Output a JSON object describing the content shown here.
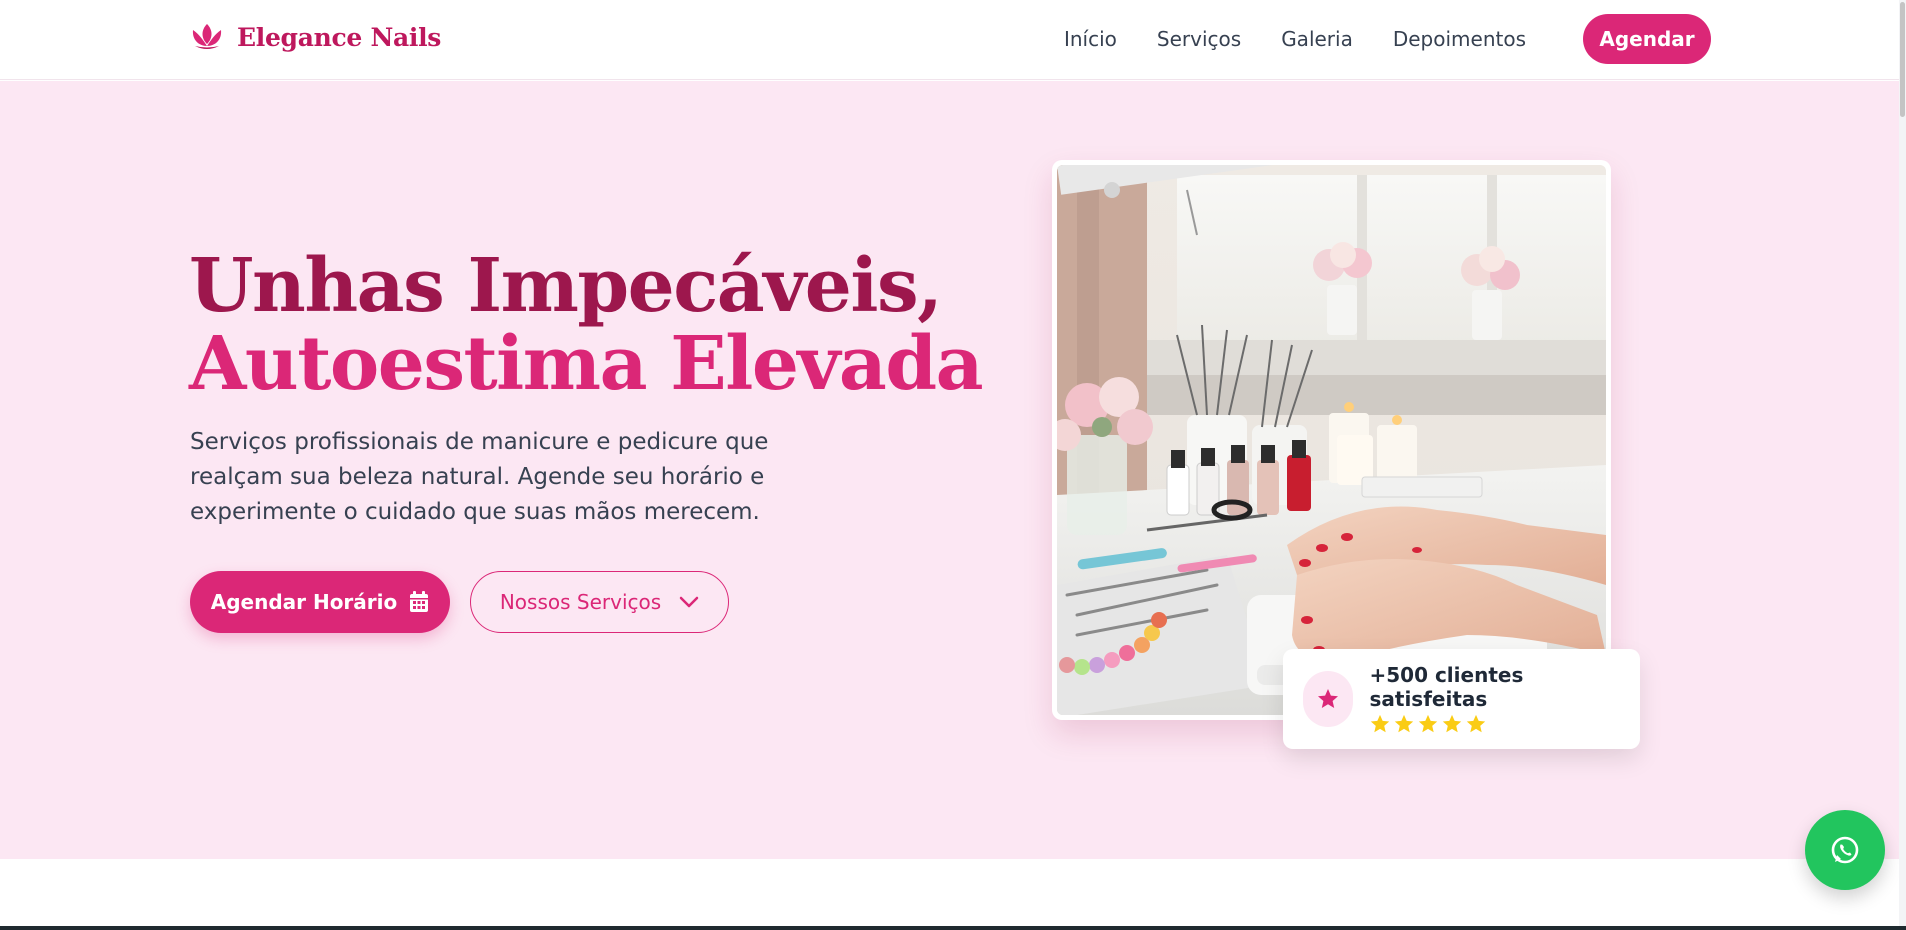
{
  "brand": {
    "name": "Elegance Nails",
    "accent": "#db2777",
    "accent_dark": "#9d174d"
  },
  "nav": {
    "items": [
      {
        "label": "Início"
      },
      {
        "label": "Serviços"
      },
      {
        "label": "Galeria"
      },
      {
        "label": "Depoimentos"
      }
    ],
    "cta_label": "Agendar"
  },
  "hero": {
    "title_line1": "Unhas Impecáveis,",
    "title_line2": "Autoestima Elevada",
    "description": "Serviços profissionais de manicure e pedicure que realçam sua beleza natural. Agende seu horário e experimente o cuidado que suas mãos merecem.",
    "primary_button": "Agendar Horário",
    "primary_icon": "calendar-icon",
    "secondary_button": "Nossos Serviços",
    "secondary_icon": "chevron-down-icon",
    "image_alt": "manicure-salon-photo"
  },
  "rating_card": {
    "title": "+500 clientes satisfeitas",
    "stars": 5,
    "icon": "star-icon"
  },
  "floating": {
    "whatsapp_icon": "whatsapp-icon",
    "color": "#22c55e"
  }
}
